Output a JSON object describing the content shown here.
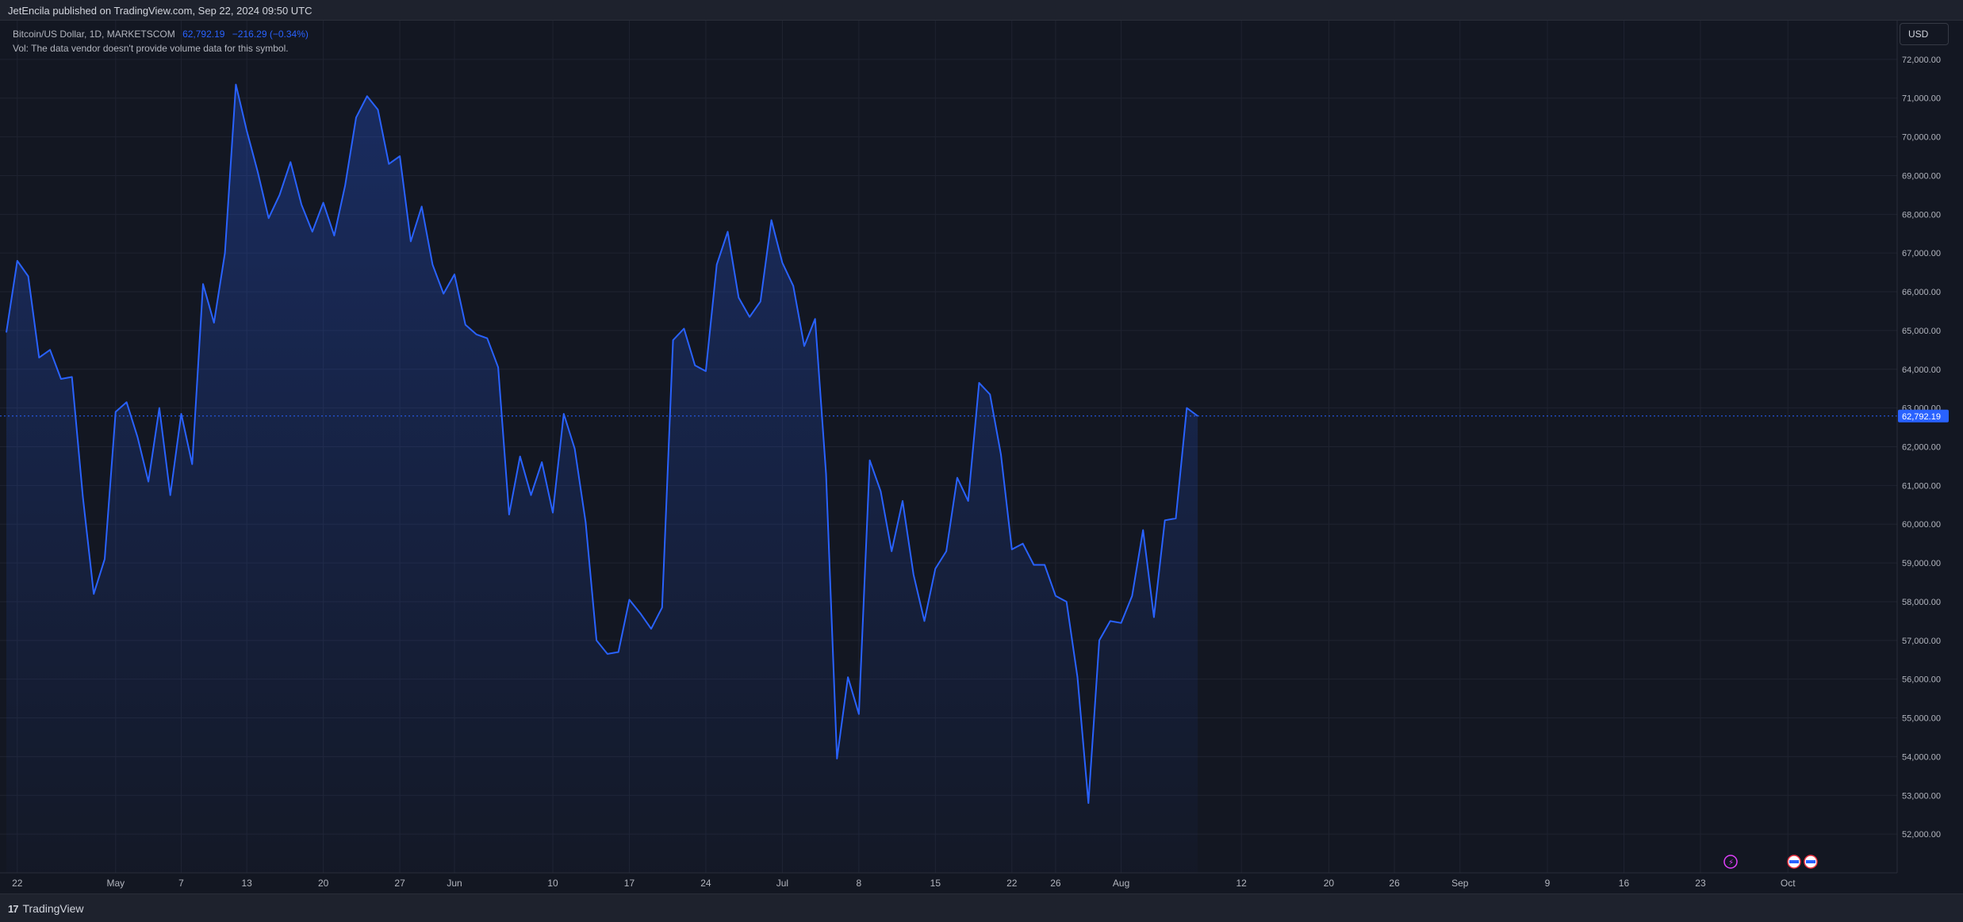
{
  "header": {
    "published": "JetEncila published on TradingView.com, Sep 22, 2024 09:50 UTC"
  },
  "legend": {
    "symbol": "Bitcoin/US Dollar, 1D, MARKETSCOM",
    "price": "62,792.19",
    "change": "−216.29 (−0.34%)",
    "volume_note": "Vol: The data vendor doesn't provide volume data for this symbol."
  },
  "currency_button": "USD",
  "footer": {
    "brand": "TradingView",
    "brand_mark": "17"
  },
  "colors": {
    "line": "#2962ff",
    "background": "#131722",
    "grid": "#1f2330",
    "axis_text": "#b2b5be"
  },
  "icons": [
    "lightning-event-icon",
    "us-flag-event-icon",
    "us-flag-event-icon"
  ],
  "chart_data": {
    "type": "area",
    "title": "Bitcoin/US Dollar, 1D, MARKETSCOM",
    "last_price_label": "62,792.19",
    "last_price": 62792.19,
    "y_ticks": [
      52000,
      53000,
      54000,
      55000,
      56000,
      57000,
      58000,
      59000,
      60000,
      61000,
      62000,
      63000,
      64000,
      65000,
      66000,
      67000,
      68000,
      69000,
      70000,
      71000,
      72000
    ],
    "y_tick_labels": [
      "52,000.00",
      "53,000.00",
      "54,000.00",
      "55,000.00",
      "56,000.00",
      "57,000.00",
      "58,000.00",
      "59,000.00",
      "60,000.00",
      "61,000.00",
      "62,000.00",
      "63,000.00",
      "64,000.00",
      "65,000.00",
      "66,000.00",
      "67,000.00",
      "68,000.00",
      "69,000.00",
      "70,000.00",
      "71,000.00",
      "72,000.00"
    ],
    "ylim": [
      51000,
      73000
    ],
    "x_ticks": [
      {
        "label": "22",
        "x": "2024-04-22"
      },
      {
        "label": "May",
        "x": "2024-05-01"
      },
      {
        "label": "7",
        "x": "2024-05-07"
      },
      {
        "label": "13",
        "x": "2024-05-13"
      },
      {
        "label": "20",
        "x": "2024-05-20"
      },
      {
        "label": "27",
        "x": "2024-05-27"
      },
      {
        "label": "Jun",
        "x": "2024-06-01"
      },
      {
        "label": "10",
        "x": "2024-06-10"
      },
      {
        "label": "17",
        "x": "2024-06-17"
      },
      {
        "label": "24",
        "x": "2024-06-24"
      },
      {
        "label": "Jul",
        "x": "2024-07-01"
      },
      {
        "label": "8",
        "x": "2024-07-08"
      },
      {
        "label": "15",
        "x": "2024-07-15"
      },
      {
        "label": "22",
        "x": "2024-07-22"
      },
      {
        "label": "26",
        "x": "2024-07-26"
      },
      {
        "label": "Aug",
        "x": "2024-08-01"
      },
      {
        "label": "12",
        "x": "2024-08-12"
      },
      {
        "label": "20",
        "x": "2024-08-20"
      },
      {
        "label": "26",
        "x": "2024-08-26"
      },
      {
        "label": "Sep",
        "x": "2024-09-01"
      },
      {
        "label": "9",
        "x": "2024-09-09"
      },
      {
        "label": "16",
        "x": "2024-09-16"
      },
      {
        "label": "23",
        "x": "2024-09-23"
      },
      {
        "label": "Oct",
        "x": "2024-10-01"
      }
    ],
    "xlim": [
      "2024-04-21",
      "2024-10-11"
    ],
    "series": [
      {
        "values": [
          [
            "2024-04-21",
            64950
          ],
          [
            "2024-04-22",
            66800
          ],
          [
            "2024-04-23",
            66400
          ],
          [
            "2024-04-24",
            64300
          ],
          [
            "2024-04-25",
            64500
          ],
          [
            "2024-04-26",
            63750
          ],
          [
            "2024-04-27",
            63800
          ],
          [
            "2024-04-28",
            60700
          ],
          [
            "2024-04-29",
            58200
          ],
          [
            "2024-04-30",
            59100
          ],
          [
            "2024-05-01",
            62900
          ],
          [
            "2024-05-02",
            63150
          ],
          [
            "2024-05-03",
            62250
          ],
          [
            "2024-05-04",
            61100
          ],
          [
            "2024-05-05",
            63000
          ],
          [
            "2024-05-06",
            60750
          ],
          [
            "2024-05-07",
            62850
          ],
          [
            "2024-05-08",
            61550
          ],
          [
            "2024-05-09",
            66200
          ],
          [
            "2024-05-10",
            65200
          ],
          [
            "2024-05-11",
            67000
          ],
          [
            "2024-05-12",
            71350
          ],
          [
            "2024-05-13",
            70150
          ],
          [
            "2024-05-14",
            69100
          ],
          [
            "2024-05-15",
            67900
          ],
          [
            "2024-05-16",
            68500
          ],
          [
            "2024-05-17",
            69350
          ],
          [
            "2024-05-18",
            68250
          ],
          [
            "2024-05-19",
            67550
          ],
          [
            "2024-05-20",
            68300
          ],
          [
            "2024-05-21",
            67450
          ],
          [
            "2024-05-22",
            68750
          ],
          [
            "2024-05-23",
            70500
          ],
          [
            "2024-05-24",
            71050
          ],
          [
            "2024-05-25",
            70700
          ],
          [
            "2024-05-26",
            69300
          ],
          [
            "2024-05-27",
            69500
          ],
          [
            "2024-05-28",
            67300
          ],
          [
            "2024-05-29",
            68200
          ],
          [
            "2024-05-30",
            66700
          ],
          [
            "2024-05-31",
            65950
          ],
          [
            "2024-06-01",
            66450
          ],
          [
            "2024-06-02",
            65150
          ],
          [
            "2024-06-03",
            64900
          ],
          [
            "2024-06-04",
            64800
          ],
          [
            "2024-06-05",
            64050
          ],
          [
            "2024-06-06",
            60250
          ],
          [
            "2024-06-07",
            61750
          ],
          [
            "2024-06-08",
            60750
          ],
          [
            "2024-06-09",
            61600
          ],
          [
            "2024-06-10",
            60300
          ],
          [
            "2024-06-11",
            62850
          ],
          [
            "2024-06-12",
            61950
          ],
          [
            "2024-06-13",
            60050
          ],
          [
            "2024-06-14",
            57000
          ],
          [
            "2024-06-15",
            56650
          ],
          [
            "2024-06-16",
            56700
          ],
          [
            "2024-06-17",
            58050
          ],
          [
            "2024-06-18",
            57700
          ],
          [
            "2024-06-19",
            57300
          ],
          [
            "2024-06-20",
            57850
          ],
          [
            "2024-06-21",
            64750
          ],
          [
            "2024-06-22",
            65050
          ],
          [
            "2024-06-23",
            64100
          ],
          [
            "2024-06-24",
            63950
          ],
          [
            "2024-06-25",
            66700
          ],
          [
            "2024-06-26",
            67550
          ],
          [
            "2024-06-27",
            65850
          ],
          [
            "2024-06-28",
            65350
          ],
          [
            "2024-06-29",
            65750
          ],
          [
            "2024-06-30",
            67850
          ],
          [
            "2024-07-01",
            66750
          ],
          [
            "2024-07-02",
            66150
          ],
          [
            "2024-07-03",
            64600
          ],
          [
            "2024-07-04",
            65300
          ],
          [
            "2024-07-05",
            61300
          ],
          [
            "2024-07-06",
            53950
          ],
          [
            "2024-07-07",
            56050
          ],
          [
            "2024-07-08",
            55100
          ],
          [
            "2024-07-09",
            61650
          ],
          [
            "2024-07-10",
            60850
          ],
          [
            "2024-07-11",
            59300
          ],
          [
            "2024-07-12",
            60600
          ],
          [
            "2024-07-13",
            58700
          ],
          [
            "2024-07-14",
            57500
          ],
          [
            "2024-07-15",
            58850
          ],
          [
            "2024-07-16",
            59300
          ],
          [
            "2024-07-17",
            61200
          ],
          [
            "2024-07-18",
            60600
          ],
          [
            "2024-07-19",
            63650
          ],
          [
            "2024-07-20",
            63350
          ],
          [
            "2024-07-21",
            61800
          ],
          [
            "2024-07-22",
            59350
          ],
          [
            "2024-07-23",
            59500
          ],
          [
            "2024-07-24",
            58950
          ],
          [
            "2024-07-25",
            58950
          ],
          [
            "2024-07-26",
            58150
          ],
          [
            "2024-07-27",
            58000
          ],
          [
            "2024-07-28",
            56050
          ],
          [
            "2024-07-29",
            52800
          ],
          [
            "2024-07-30",
            57000
          ],
          [
            "2024-07-31",
            57500
          ],
          [
            "2024-08-01",
            57450
          ],
          [
            "2024-08-02",
            58150
          ],
          [
            "2024-08-03",
            59850
          ],
          [
            "2024-08-04",
            57600
          ],
          [
            "2024-08-05",
            60100
          ],
          [
            "2024-08-06",
            60150
          ],
          [
            "2024-08-07",
            63000
          ],
          [
            "2024-08-08",
            62792.19
          ]
        ]
      }
    ],
    "grid": true
  }
}
